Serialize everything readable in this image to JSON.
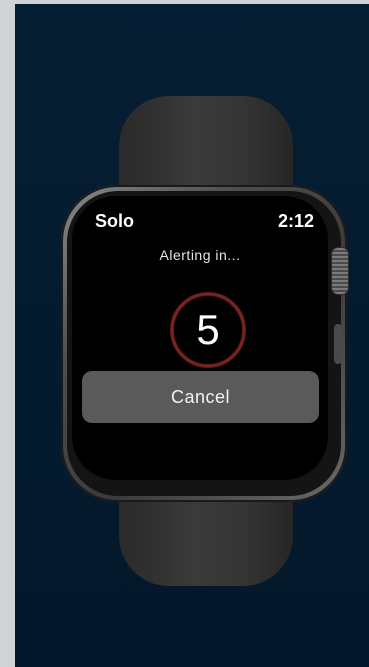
{
  "watch_app": {
    "title": "Solo",
    "time": "2:12",
    "status": "Alerting in...",
    "countdown": "5",
    "cancel_label": "Cancel"
  },
  "colors": {
    "background": "#041a2e",
    "ring": "#6e1e1c",
    "button": "#5a5a5a"
  }
}
